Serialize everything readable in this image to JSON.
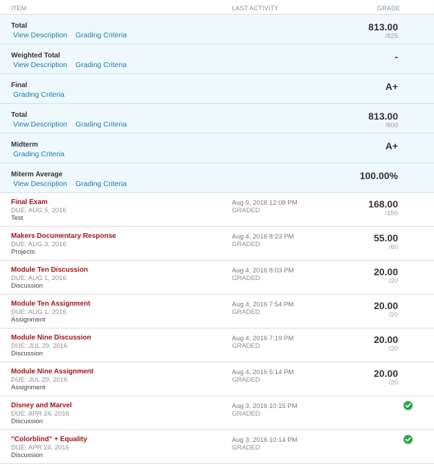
{
  "header": {
    "item": "ITEM",
    "last_activity": "LAST ACTIVITY",
    "grade": "GRADE"
  },
  "categories": [
    {
      "title": "Total",
      "links": [
        "View Description",
        "Grading Criteria"
      ],
      "grade": "813.00",
      "sub": "/825"
    },
    {
      "title": "Weighted Total",
      "links": [
        "View Description",
        "Grading Criteria"
      ],
      "grade": "-",
      "sub": ""
    },
    {
      "title": "Final",
      "links": [
        "Grading Criteria"
      ],
      "grade": "A+",
      "sub": ""
    },
    {
      "title": "Total",
      "links": [
        "View Description",
        "Grading Criteria"
      ],
      "grade": "813.00",
      "sub": "/800"
    },
    {
      "title": "Midterm",
      "links": [
        "Grading Criteria"
      ],
      "grade": "A+",
      "sub": ""
    },
    {
      "title": "Miterm Average",
      "links": [
        "View Description",
        "Grading Criteria"
      ],
      "grade": "100.00%",
      "sub": ""
    }
  ],
  "items": [
    {
      "title": "Final Exam",
      "due": "DUE: AUG 5, 2016",
      "type": "Test",
      "date": "Aug 9, 2016 12:08 PM",
      "status": "GRADED",
      "grade": "168.00",
      "sub": "/150",
      "check": false
    },
    {
      "title": "Makers Documentary Response",
      "due": "DUE: AUG 3, 2016",
      "type": "Projects",
      "date": "Aug 4, 2016 8:23 PM",
      "status": "GRADED",
      "grade": "55.00",
      "sub": "/60",
      "check": false
    },
    {
      "title": "Module Ten Discussion",
      "due": "DUE: AUG 1, 2016",
      "type": "Discussion",
      "date": "Aug 4, 2016 8:03 PM",
      "status": "GRADED",
      "grade": "20.00",
      "sub": "/20",
      "check": false
    },
    {
      "title": "Module Ten Assignment",
      "due": "DUE: AUG 1, 2016",
      "type": "Assignment",
      "date": "Aug 4, 2016 7:54 PM",
      "status": "GRADED",
      "grade": "20.00",
      "sub": "/20",
      "check": false
    },
    {
      "title": "Module Nine Discussion",
      "due": "DUE: JUL 29, 2016",
      "type": "Discussion",
      "date": "Aug 4, 2016 7:19 PM",
      "status": "GRADED",
      "grade": "20.00",
      "sub": "/20",
      "check": false
    },
    {
      "title": "Module Nine Assignment",
      "due": "DUE: JUL 29, 2016",
      "type": "Assignment",
      "date": "Aug 4, 2016 5:14 PM",
      "status": "GRADED",
      "grade": "20.00",
      "sub": "/20",
      "check": false
    },
    {
      "title": "Disney and Marvel",
      "due": "DUE: APR 24, 2016",
      "type": "Discussion",
      "date": "Aug 3, 2016 10:15 PM",
      "status": "GRADED",
      "grade": "",
      "sub": "",
      "check": true
    },
    {
      "title": "\"Colorblind\" + Equality",
      "due": "DUE: APR 24, 2016",
      "type": "Discussion",
      "date": "Aug 3, 2016 10:14 PM",
      "status": "GRADED",
      "grade": "",
      "sub": "",
      "check": true
    }
  ],
  "colors": {
    "category_bg": "#eef8fd",
    "link": "#1a7ba7",
    "item_title": "#a3141b",
    "check": "#27a644"
  },
  "icons": {
    "completed": "check-circle-icon"
  }
}
